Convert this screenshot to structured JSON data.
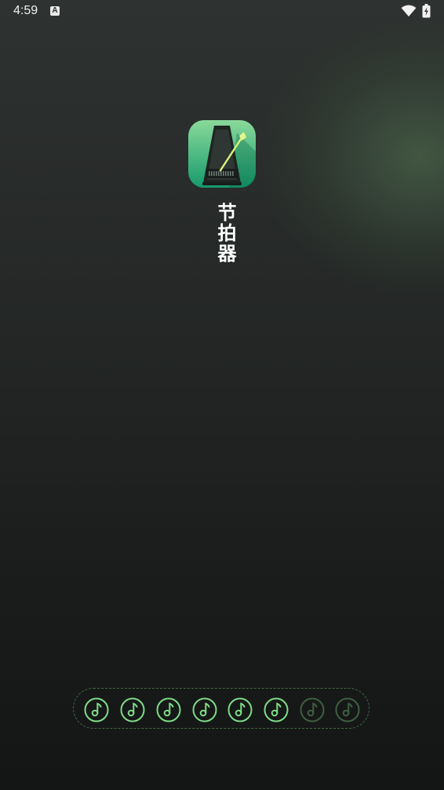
{
  "status_bar": {
    "time": "4:59",
    "notification_icon": "a-letter-icon",
    "notification_glyph": "A",
    "wifi_icon": "wifi-icon",
    "battery_icon": "battery-charging-icon"
  },
  "app": {
    "name": "节拍器",
    "icon": "metronome-icon"
  },
  "beats": {
    "total": 8,
    "active": 6,
    "icon": "music-note-icon",
    "active_color": "#7ddc86",
    "inactive_color": "#3e5f41"
  },
  "colors": {
    "accent": "#7ddc86",
    "background_top": "#2e3230",
    "background_bottom": "#141515",
    "icon_gradient_top": "#8ad99a",
    "icon_gradient_bottom": "#159a6c"
  }
}
